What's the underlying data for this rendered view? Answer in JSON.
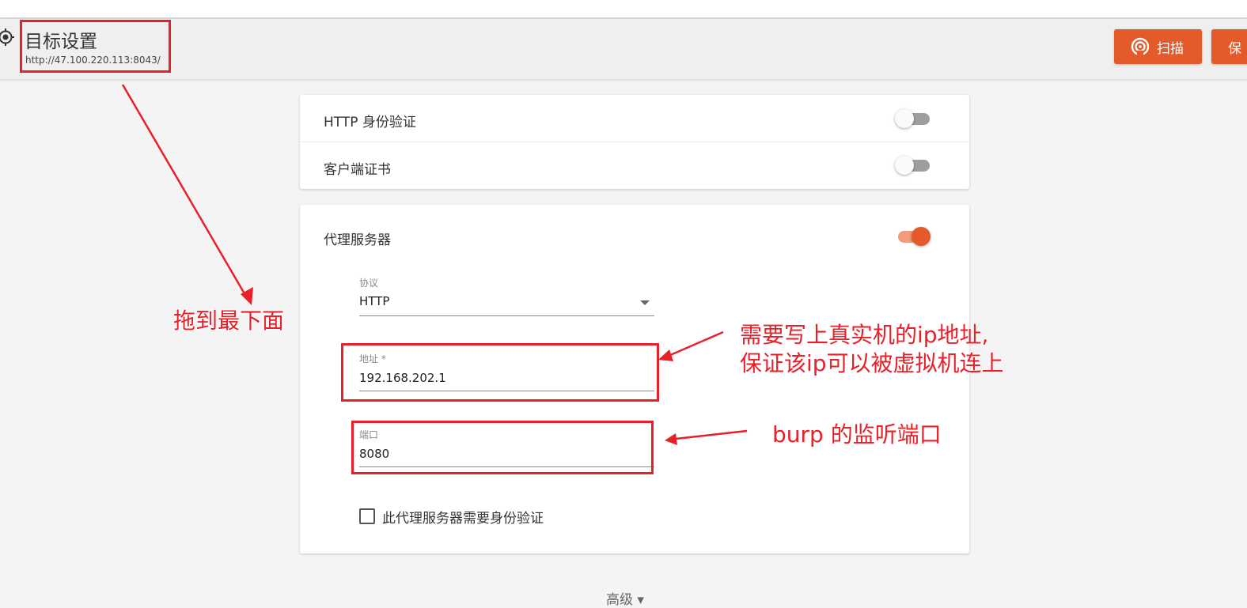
{
  "header": {
    "title": "目标设置",
    "url": "http://47.100.220.113:8043/",
    "scan_label": "扫描",
    "save_label": "保"
  },
  "auth_card": {
    "http_auth_label": "HTTP 身份验证",
    "http_auth_enabled": false,
    "client_cert_label": "客户端证书",
    "client_cert_enabled": false
  },
  "proxy_card": {
    "title": "代理服务器",
    "enabled": true,
    "protocol_label": "协议",
    "protocol_value": "HTTP",
    "address_label": "地址 *",
    "address_value": "192.168.202.1",
    "port_label": "端口",
    "port_value": "8080",
    "auth_checkbox_label": "此代理服务器需要身份验证",
    "auth_checkbox_checked": false
  },
  "footer": {
    "advanced_label": "高级 ▾"
  },
  "annotations": {
    "drag_note": "拖到最下面",
    "ip_note_line1": "需要写上真实机的ip地址,",
    "ip_note_line2": "保证该ip可以被虚拟机连上",
    "port_note": "burp 的监听端口"
  },
  "colors": {
    "accent": "#e45a2a",
    "annotation": "#e8202a"
  }
}
